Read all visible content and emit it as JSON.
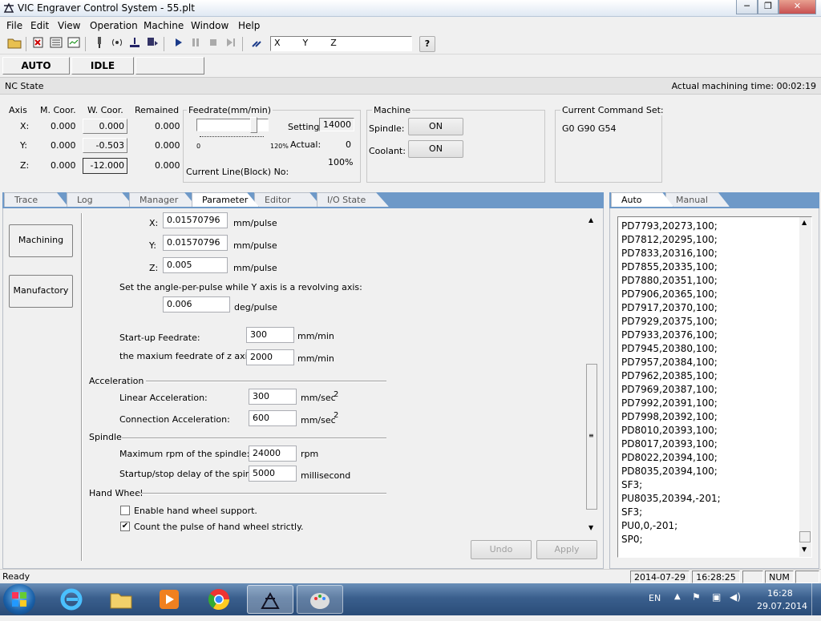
{
  "window": {
    "title": "VIC Engraver Control System  - 55.plt",
    "minimize": "─",
    "maximize": "❐",
    "close": "✕"
  },
  "menu": [
    "File",
    "Edit",
    "View",
    "Operation",
    "Machine",
    "Window",
    "Help"
  ],
  "toolbar": {
    "coords_text": "X        Y        Z",
    "help": "?"
  },
  "status_top": {
    "mode": "AUTO",
    "state": "IDLE",
    "extra": ""
  },
  "nc_state": {
    "title": "NC State",
    "machining_time": "Actual machining time: 00:02:19"
  },
  "axis": {
    "headers": [
      "Axis",
      "M. Coor.",
      "W. Coor.",
      "Remained"
    ],
    "rows": [
      {
        "axis": "X:",
        "m": "0.000",
        "w": "0.000",
        "r": "0.000"
      },
      {
        "axis": "Y:",
        "m": "0.000",
        "w": "-0.503",
        "r": "0.000"
      },
      {
        "axis": "Z:",
        "m": "0.000",
        "w": "-12.000",
        "r": "0.000"
      }
    ]
  },
  "feedrate": {
    "title": "Feedrate(mm/min)",
    "setting_label": "Setting:",
    "setting_value": "14000",
    "actual_label": "Actual:",
    "actual_value": "0",
    "percent": "100%",
    "scale_min": "0",
    "scale_max": "120%",
    "current_line": "Current Line(Block) No:",
    "slider_level_pct": 100
  },
  "machine": {
    "title": "Machine",
    "spindle_label": "Spindle:",
    "spindle_btn": "ON",
    "coolant_label": "Coolant:",
    "coolant_btn": "ON"
  },
  "command_set": {
    "title": "Current Command Set:",
    "value": "G0 G90 G54"
  },
  "left_tabs": [
    "Trace",
    "Log",
    "Manager",
    "Parameter",
    "Editor",
    "I/O State"
  ],
  "side_buttons": [
    "Machining",
    "Manufactory"
  ],
  "params": {
    "x_label": "X:",
    "x_value": "0.01570796",
    "x_unit": "mm/pulse",
    "y_label": "Y:",
    "y_value": "0.01570796",
    "y_unit": "mm/pulse",
    "z_label": "Z:",
    "z_value": "0.005",
    "z_unit": "mm/pulse",
    "angle_text": "Set the angle-per-pulse while Y axis is a revolving axis:",
    "angle_value": "0.006",
    "angle_unit": "deg/pulse",
    "startup_label": "Start-up Feedrate:",
    "startup_value": "300",
    "startup_unit": "mm/min",
    "maxz_label": "the maxium feedrate of z axis:",
    "maxz_value": "2000",
    "maxz_unit": "mm/min",
    "accel_title": "Acceleration",
    "linear_label": "Linear Acceleration:",
    "linear_value": "300",
    "linear_unit": "mm/sec",
    "conn_label": "Connection Acceleration:",
    "conn_value": "600",
    "conn_unit": "mm/sec",
    "sq": "2",
    "spindle_title": "Spindle",
    "maxrpm_label": "Maximum rpm of the spindle:",
    "maxrpm_value": "24000",
    "maxrpm_unit": "rpm",
    "delay_label": "Startup/stop delay of the spindle:",
    "delay_value": "5000",
    "delay_unit": "millisecond",
    "handwheel_title": "Hand Wheel",
    "hw_enable": "Enable hand wheel support.",
    "hw_enable_checked": false,
    "hw_count": "Count the pulse of hand wheel strictly.",
    "hw_count_checked": true,
    "undo": "Undo",
    "apply": "Apply"
  },
  "right_tabs": [
    "Auto",
    "Manual"
  ],
  "code_lines": [
    "PD7793,20273,100;",
    "PD7812,20295,100;",
    "PD7833,20316,100;",
    "PD7855,20335,100;",
    "PD7880,20351,100;",
    "PD7906,20365,100;",
    "PD7917,20370,100;",
    "PD7929,20375,100;",
    "PD7933,20376,100;",
    "PD7945,20380,100;",
    "PD7957,20384,100;",
    "PD7962,20385,100;",
    "PD7969,20387,100;",
    "PD7992,20391,100;",
    "PD7998,20392,100;",
    "PD8010,20393,100;",
    "PD8017,20393,100;",
    "PD8022,20394,100;",
    "PD8035,20394,100;",
    "SF3;",
    "PU8035,20394,-201;",
    "SF3;",
    "PU0,0,-201;",
    "SP0;"
  ],
  "statusbar": {
    "ready": "Ready",
    "date": "2014-07-29",
    "time": "16:28:25",
    "num": "NUM"
  },
  "taskbar": {
    "lang": "EN",
    "clock_time": "16:28",
    "clock_date": "29.07.2014"
  }
}
